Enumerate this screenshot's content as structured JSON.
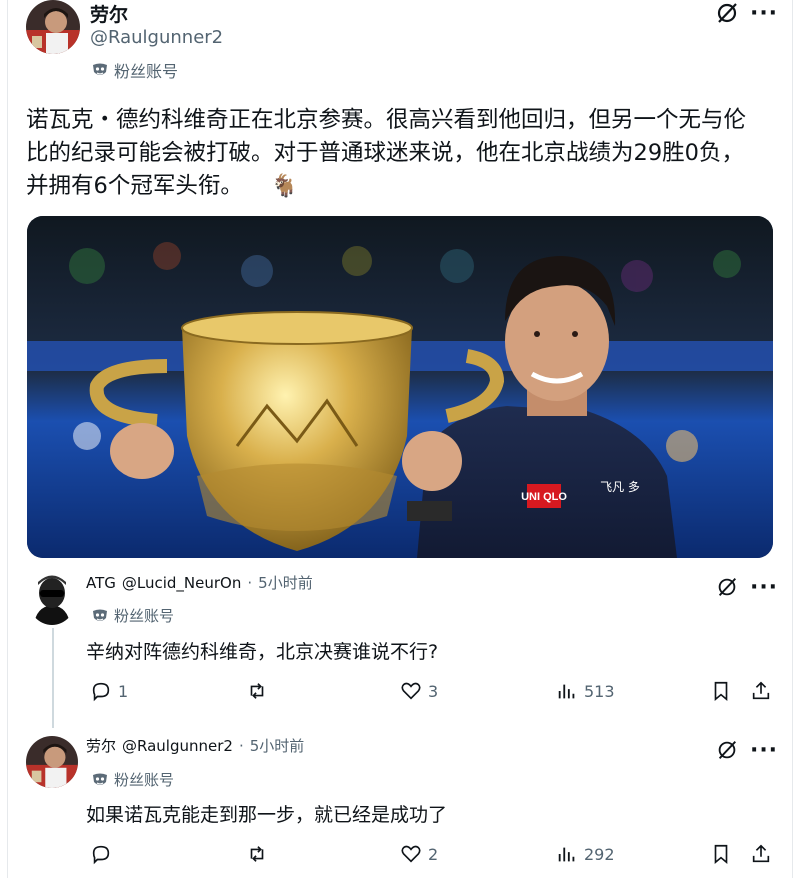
{
  "main_post": {
    "author_name": "劳尔",
    "author_handle": "@Raulgunner2",
    "badge": "粉丝账号",
    "text": "诺瓦克・德约科维奇正在北京参赛。很高兴看到他回归，但另一个无与伦比的纪录可能会被打破。对于普通球迷来说，他在北京战绩为29胜0负，并拥有6个冠军头衔。",
    "emoji": "🐐",
    "media_text": {
      "sponsor_logo": "UNI QLO",
      "chest_text": "飞凡 多"
    }
  },
  "replies": [
    {
      "author_name": "ATG",
      "author_handle": "@Lucid_NeurOn",
      "dot": "·",
      "time": "5小时前",
      "badge": "粉丝账号",
      "text": "辛纳对阵德约科维奇，北京决赛谁说不行?",
      "replies": "1",
      "retweets": "",
      "likes": "3",
      "views": "513"
    },
    {
      "author_name": "劳尔",
      "author_handle": "@Raulgunner2",
      "dot": "·",
      "time": "5小时前",
      "badge": "粉丝账号",
      "text": "如果诺瓦克能走到那一步，就已经是成功了",
      "replies": "",
      "retweets": "",
      "likes": "2",
      "views": "292"
    }
  ],
  "icons": {
    "mute": "mute-icon",
    "more": "more-icon",
    "reply": "reply-icon",
    "retweet": "retweet-icon",
    "like": "like-icon",
    "views": "views-icon",
    "bookmark": "bookmark-icon",
    "share": "share-icon",
    "badge": "fan-mask-icon"
  },
  "colors": {
    "text": "#0f1419",
    "secondary": "#536471",
    "divider": "#e6e9ec"
  }
}
